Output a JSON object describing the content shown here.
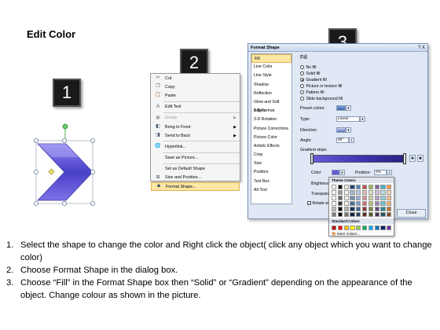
{
  "page": {
    "title": "Edit Color"
  },
  "steps": [
    {
      "number": "1"
    },
    {
      "number": "2"
    },
    {
      "number": "3"
    }
  ],
  "context_menu": {
    "items": [
      {
        "label": "Cut",
        "icon": "scissors-icon",
        "disabled": false
      },
      {
        "label": "Copy",
        "icon": "copy-icon",
        "disabled": false
      },
      {
        "label": "Paste",
        "icon": "paste-icon",
        "disabled": false
      },
      {
        "label": "Edit Text",
        "icon": "edit-text-icon",
        "disabled": false
      },
      {
        "label": "Group",
        "icon": "group-icon",
        "disabled": true,
        "submenu": true
      },
      {
        "label": "Bring to Front",
        "icon": "bring-front-icon",
        "disabled": false,
        "submenu": true
      },
      {
        "label": "Send to Back",
        "icon": "send-back-icon",
        "disabled": false,
        "submenu": true
      },
      {
        "label": "Hyperlink...",
        "icon": "hyperlink-icon",
        "disabled": false
      },
      {
        "label": "Save as Picture...",
        "icon": "",
        "disabled": false
      },
      {
        "label": "Set as Default Shape",
        "icon": "",
        "disabled": false
      },
      {
        "label": "Size and Position...",
        "icon": "size-icon",
        "disabled": false
      },
      {
        "label": "Format Shape...",
        "icon": "format-shape-icon",
        "disabled": false,
        "selected": true
      }
    ]
  },
  "dialog": {
    "title": "Format Shape",
    "close_x": "?  X",
    "sidebar": [
      "Fill",
      "Line Color",
      "Line Style",
      "Shadow",
      "Reflection",
      "Glow and Soft Edges",
      "3-D Format",
      "3-D Rotation",
      "Picture Corrections",
      "Picture Color",
      "Artistic Effects",
      "Crop",
      "Size",
      "Position",
      "Text Box",
      "Alt Text"
    ],
    "section_title": "Fill",
    "fill_options": [
      "No fill",
      "Solid fill",
      "Gradient fill",
      "Picture or texture fill",
      "Pattern fill",
      "Slide background fill"
    ],
    "selected_option": 2,
    "preset_colors_label": "Preset colors:",
    "type_label": "Type:",
    "type_value": "Linear",
    "direction_label": "Direction:",
    "angle_label": "Angle:",
    "angle_value": "90°",
    "gradient_stops_label": "Gradient stops",
    "color_label": "Color",
    "position_label": "Position:",
    "position_value": "0%",
    "brightness_label": "Brightness",
    "transparency_label": "Transparency",
    "rotate_label": "Rotate with shape",
    "close_button": "Close"
  },
  "color_picker": {
    "theme_header": "Theme Colors",
    "standard_header": "Standard Colors",
    "more_colors": "More Colors...",
    "theme_row": [
      "#ffffff",
      "#000000",
      "#eeece1",
      "#1f497d",
      "#4f81bd",
      "#c0504d",
      "#9bbb59",
      "#8064a2",
      "#4bacc6",
      "#f79646"
    ],
    "standard_row": [
      "#c00000",
      "#ff0000",
      "#ffc000",
      "#ffff00",
      "#92d050",
      "#00b050",
      "#00b0f0",
      "#0070c0",
      "#002060",
      "#7030a0"
    ]
  },
  "instructions": [
    {
      "num": "1.",
      "text": "Select the shape to change the color and Right click the object( click any object which you want to change color)"
    },
    {
      "num": "2.",
      "text": "Choose Format Shape in the dialog box."
    },
    {
      "num": "3.",
      "text": "Choose “Fill” in the Format Shape box then “Solid” or “Gradient” depending on the appearance of the object. Change colour as shown in the picture."
    }
  ]
}
